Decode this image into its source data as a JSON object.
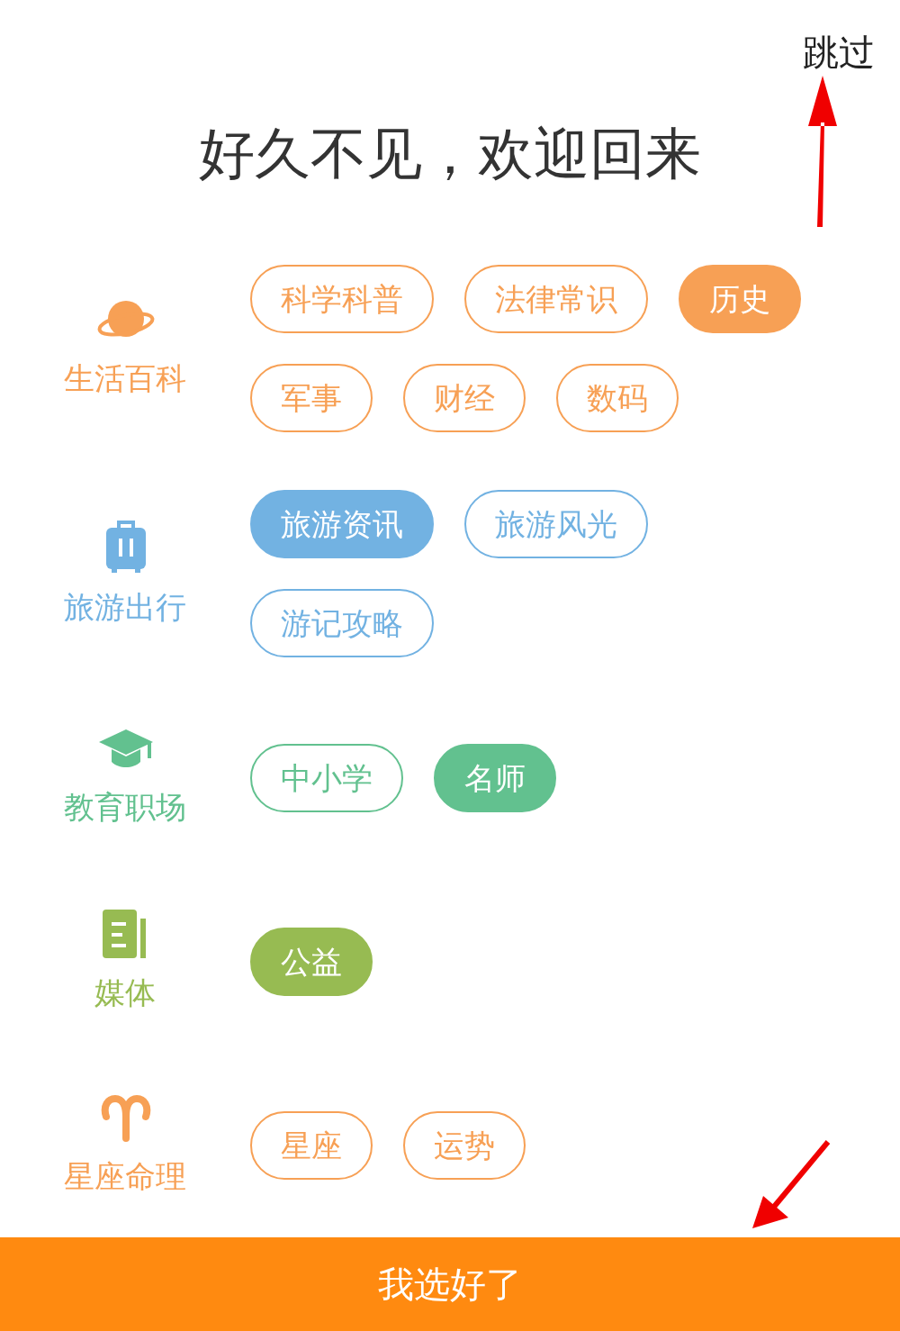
{
  "skip_link": "跳过",
  "title": "好久不见，欢迎回来",
  "categories": [
    {
      "label": "生活百科",
      "kind": "planet",
      "color": "#f7a055",
      "tags": [
        {
          "label": "科学科普",
          "selected": false
        },
        {
          "label": "法律常识",
          "selected": false
        },
        {
          "label": "历史",
          "selected": true
        },
        {
          "label": "军事",
          "selected": false
        },
        {
          "label": "财经",
          "selected": false
        },
        {
          "label": "数码",
          "selected": false
        }
      ]
    },
    {
      "label": "旅游出行",
      "kind": "suitcase",
      "color": "#72b2e2",
      "tags": [
        {
          "label": "旅游资讯",
          "selected": true
        },
        {
          "label": "旅游风光",
          "selected": false
        },
        {
          "label": "游记攻略",
          "selected": false
        }
      ]
    },
    {
      "label": "教育职场",
      "kind": "cap",
      "color": "#62c18f",
      "tags": [
        {
          "label": "中小学",
          "selected": false
        },
        {
          "label": "名师",
          "selected": true
        }
      ]
    },
    {
      "label": "媒体",
      "kind": "document",
      "color": "#97bb52",
      "tags": [
        {
          "label": "公益",
          "selected": true
        }
      ]
    },
    {
      "label": "星座命理",
      "kind": "aries",
      "color": "#f7a055",
      "tags": [
        {
          "label": "星座",
          "selected": false
        },
        {
          "label": "运势",
          "selected": false
        }
      ]
    }
  ],
  "confirm_button": "我选好了"
}
